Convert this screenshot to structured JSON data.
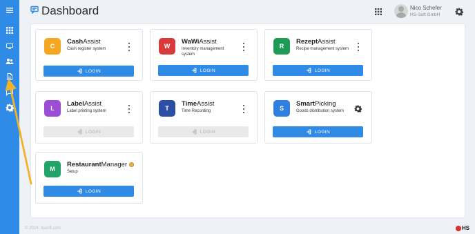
{
  "header": {
    "title": "Dashboard",
    "user_name": "Nico Schefer",
    "user_company": "HS-Soft GmbH"
  },
  "sidebar": {
    "items": [
      {
        "icon": "menu-icon"
      },
      {
        "icon": "apps-icon"
      },
      {
        "icon": "monitor-icon"
      },
      {
        "icon": "users-icon"
      },
      {
        "icon": "document-icon"
      },
      {
        "icon": "chat-icon"
      },
      {
        "icon": "settings-icon"
      }
    ]
  },
  "apps": [
    {
      "name_bold": "Cash",
      "name_rest": "Assist",
      "desc": "Cash register system",
      "logo_letter": "C",
      "logo_color": "#f5a623",
      "login": "LOGIN",
      "login_enabled": true,
      "action": "kebab-menu"
    },
    {
      "name_bold": "WaWi",
      "name_rest": "Assist",
      "desc": "Inventory management system",
      "logo_letter": "W",
      "logo_color": "#d83b3b",
      "login": "LOGIN",
      "login_enabled": true,
      "action": "kebab-menu"
    },
    {
      "name_bold": "Rezept",
      "name_rest": "Assist",
      "desc": "Recipe management system",
      "logo_letter": "R",
      "logo_color": "#1f9a55",
      "login": "LOGIN",
      "login_enabled": true,
      "action": "kebab-menu"
    },
    {
      "name_bold": "Label",
      "name_rest": "Assist",
      "desc": "Label printing system",
      "logo_letter": "L",
      "logo_color": "#9b4dd6",
      "login": "LOGIN",
      "login_enabled": false,
      "action": "kebab-menu"
    },
    {
      "name_bold": "Time",
      "name_rest": "Assist",
      "desc": "Time Recording",
      "logo_letter": "T",
      "logo_color": "#2d4fa3",
      "login": "LOGIN",
      "login_enabled": false,
      "action": "kebab-menu"
    },
    {
      "name_bold": "Smart",
      "name_rest": "Picking",
      "desc": "Goods distribution system",
      "logo_letter": "S",
      "logo_color": "#2f7fe0",
      "login": "LOGIN",
      "login_enabled": true,
      "action": "gear"
    },
    {
      "name_bold": "Restaurant",
      "name_rest": "Manager",
      "desc": "Setup",
      "logo_letter": "M",
      "logo_color": "#22a36a",
      "login": "LOGIN",
      "login_enabled": true,
      "action": "badge"
    }
  ],
  "footer": {
    "copyright": "© 2024, hssoft.com",
    "brand": "HS"
  },
  "colors": {
    "sidebar": "#2f8be6",
    "primary_button": "#2f8be6",
    "disabled_button": "#e9e9e9",
    "arrow": "#f2b32b"
  }
}
